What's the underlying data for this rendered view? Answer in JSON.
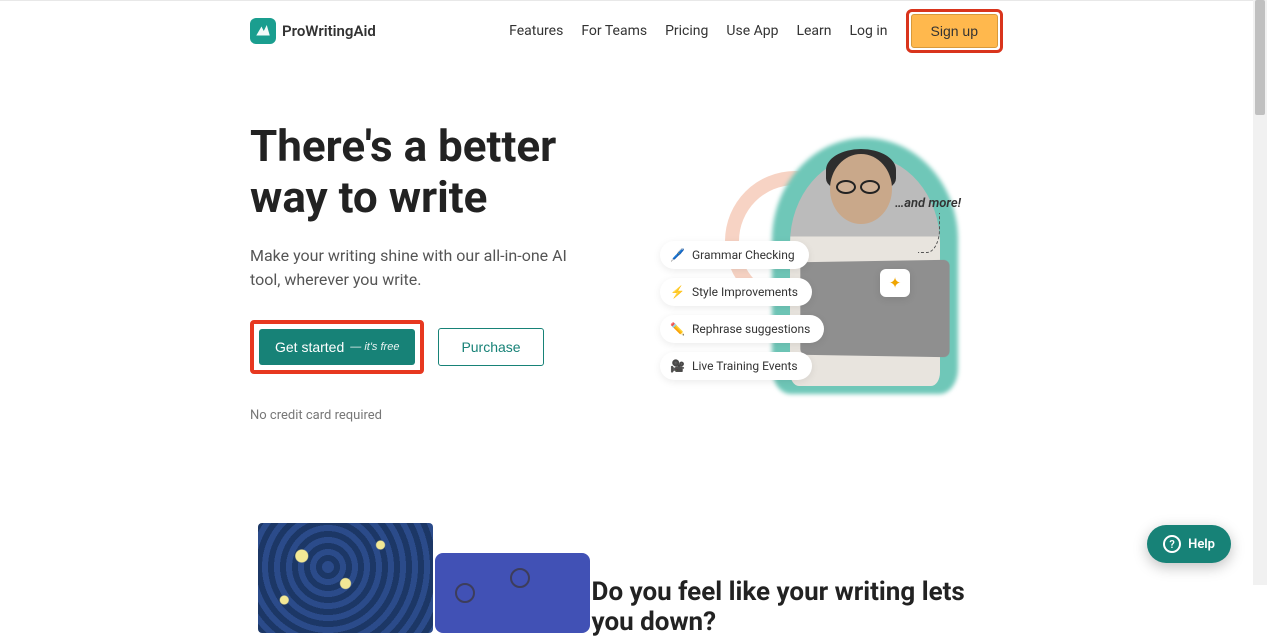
{
  "brand": "ProWritingAid",
  "nav": {
    "features": "Features",
    "teams": "For Teams",
    "pricing": "Pricing",
    "useapp": "Use App",
    "learn": "Learn",
    "login": "Log in",
    "signup": "Sign up"
  },
  "hero": {
    "headline": "There's a better way to write",
    "subhead": "Make your writing shine with our all-in-one AI tool, wherever you write.",
    "getstarted": "Get started",
    "getstarted_sub": "— it's free",
    "purchase": "Purchase",
    "nocredit": "No credit card required",
    "andmore": "…and  more!",
    "chips": [
      {
        "icon": "🖊️",
        "label": "Grammar Checking"
      },
      {
        "icon": "⚡",
        "label": "Style Improvements"
      },
      {
        "icon": "✏️",
        "label": "Rephrase suggestions"
      },
      {
        "icon": "🎥",
        "label": "Live Training Events"
      }
    ],
    "sparkle": "✦"
  },
  "section2": {
    "headline": "Do you feel like your writing lets you down?"
  },
  "help": "Help"
}
